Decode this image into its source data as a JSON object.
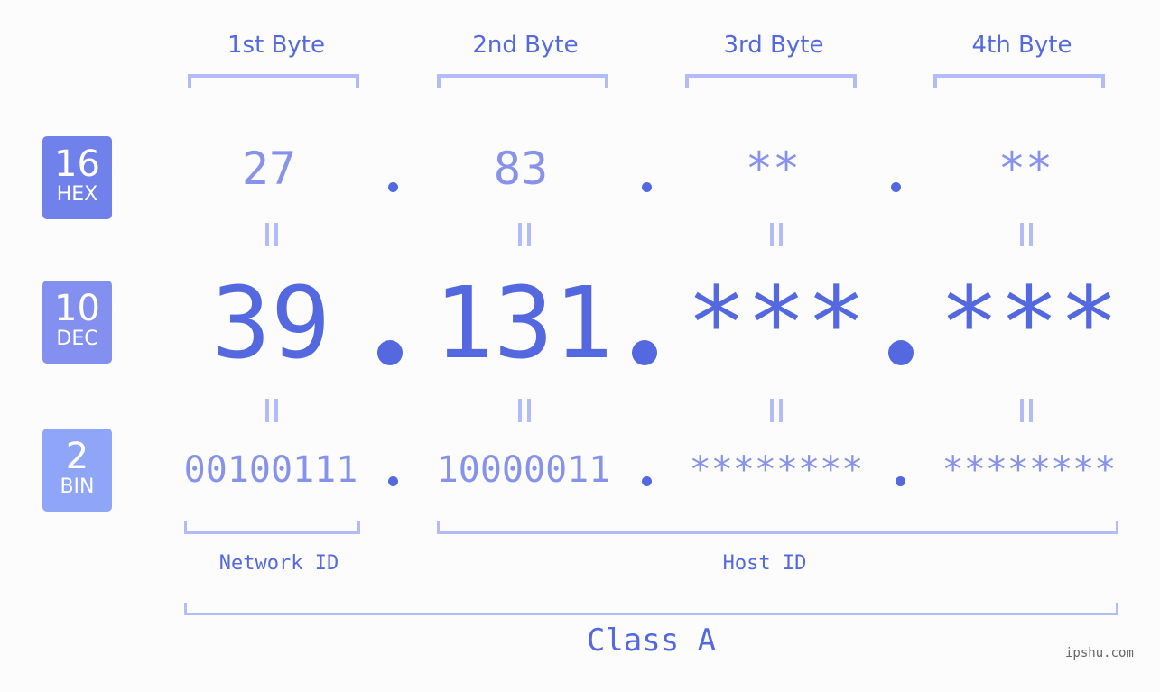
{
  "colors": {
    "hex_badge": "#7181ec",
    "dec_badge": "#8390f0",
    "bin_badge": "#8fa6f8",
    "primary_text": "#5468e0",
    "secondary_text": "#8793ea",
    "bracket": "#b3bcf7",
    "background": "#fbfcfb"
  },
  "badges": [
    {
      "base": "16",
      "label": "HEX"
    },
    {
      "base": "10",
      "label": "DEC"
    },
    {
      "base": "2",
      "label": "BIN"
    }
  ],
  "byte_headers": [
    "1st Byte",
    "2nd Byte",
    "3rd Byte",
    "4th Byte"
  ],
  "hex": [
    "27",
    "83",
    "**",
    "**"
  ],
  "dec": [
    "39",
    "131",
    "***",
    "***"
  ],
  "bin": [
    "00100111",
    "10000011",
    "********",
    "********"
  ],
  "separator": ".",
  "network_id_label": "Network ID",
  "host_id_label": "Host ID",
  "class_label": "Class A",
  "watermark": "ipshu.com"
}
